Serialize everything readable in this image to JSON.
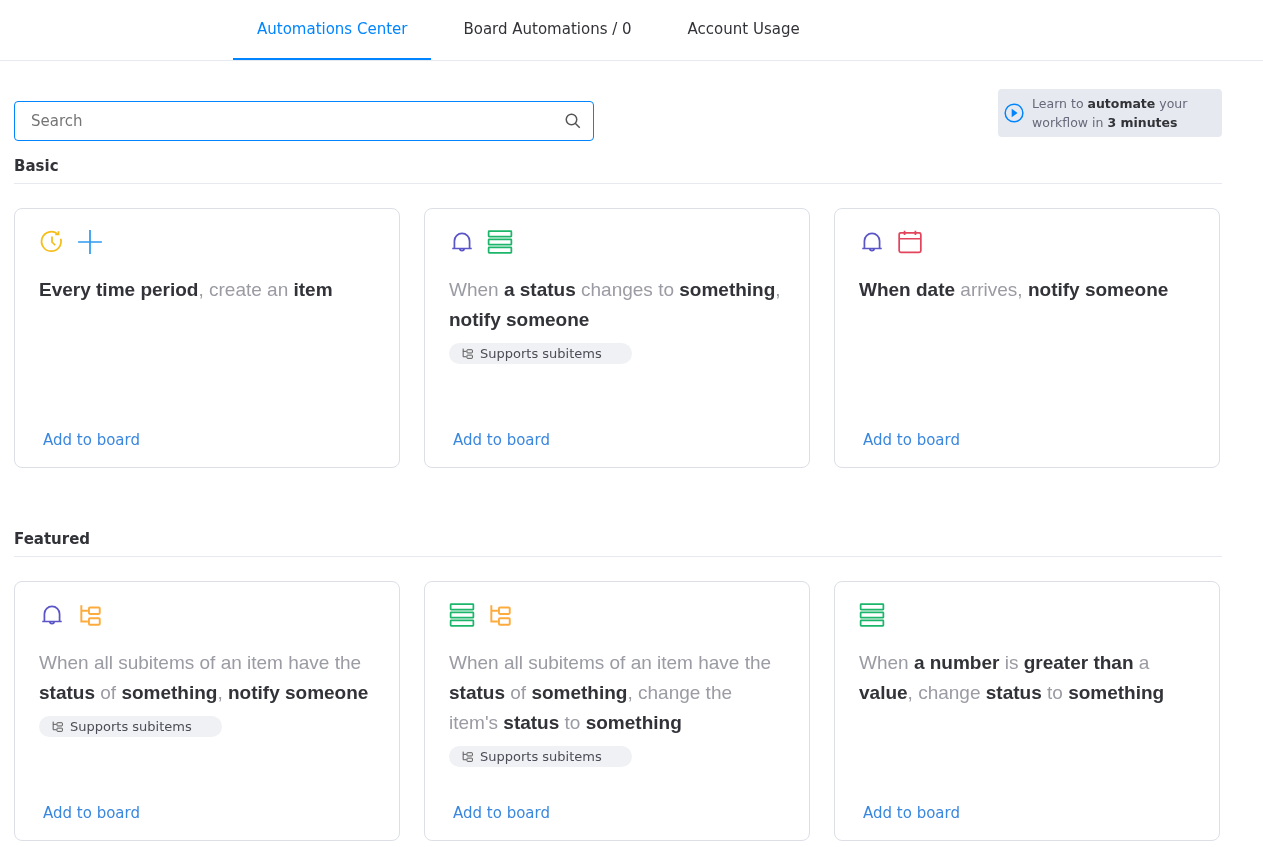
{
  "tabs": [
    {
      "label": "Automations Center",
      "selected": true
    },
    {
      "label": "Board Automations / 0",
      "selected": false
    },
    {
      "label": "Account Usage",
      "selected": false
    }
  ],
  "search": {
    "placeholder": "Search"
  },
  "video_promo": {
    "text": "Learn to **automate** your workflow in **3 minutes**"
  },
  "sections": [
    {
      "title": "Basic",
      "cards": [
        {
          "icons": [
            {
              "kind": "clock"
            },
            {
              "kind": "plus"
            }
          ],
          "text": "**Every time period**, create an **item**",
          "supports_subitems": false,
          "link": "Add to board"
        },
        {
          "icons": [
            {
              "kind": "bell"
            },
            {
              "kind": "rows"
            }
          ],
          "text": "When **a status** changes to **something**, **notify someone**",
          "supports_subitems": true,
          "badge": "Supports subitems",
          "link": "Add to board"
        },
        {
          "icons": [
            {
              "kind": "bell"
            },
            {
              "kind": "calendar"
            }
          ],
          "text": "**When date** arrives, **notify someone**",
          "supports_subitems": false,
          "link": "Add to board"
        }
      ]
    },
    {
      "title": "Featured",
      "cards": [
        {
          "icons": [
            {
              "kind": "bell"
            },
            {
              "kind": "subitems"
            }
          ],
          "text": "When all subitems of an item have the **status** of **something**, **notify someone**",
          "supports_subitems": true,
          "badge": "Supports subitems",
          "link": "Add to board"
        },
        {
          "icons": [
            {
              "kind": "rows"
            },
            {
              "kind": "subitems"
            }
          ],
          "text": "When all subitems of an item have the **status** of **something**, change the item's **status** to **something**",
          "supports_subitems": true,
          "badge": "Supports subitems",
          "link": "Add to board"
        },
        {
          "icons": [
            {
              "kind": "rows"
            }
          ],
          "text": "When **a number** is **greater than** a **value**, change **status** to **something**",
          "supports_subitems": false,
          "link": "Add to board"
        }
      ]
    }
  ]
}
